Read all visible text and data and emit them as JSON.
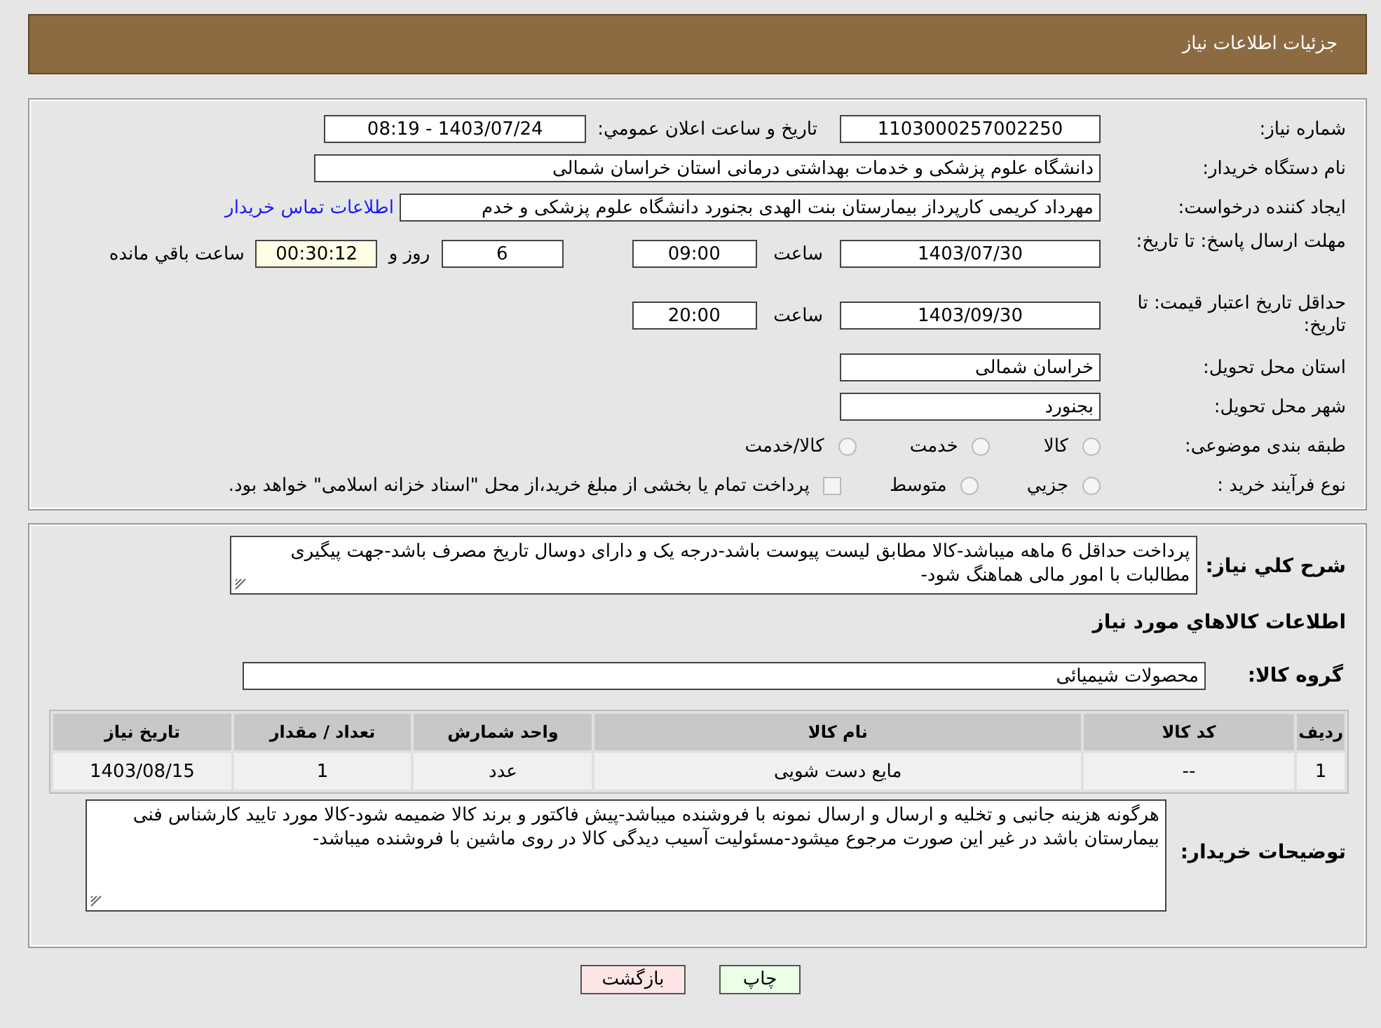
{
  "header": {
    "title": "جزئیات اطلاعات نیاز"
  },
  "need_number": {
    "label": "شماره نیاز:",
    "value": "1103000257002250"
  },
  "announce": {
    "label": "تاریخ و ساعت اعلان عمومي:",
    "value": "1403/07/24 - 08:19"
  },
  "buyer_org": {
    "label": "نام دستگاه خریدار:",
    "value": "دانشگاه علوم پزشکی و خدمات بهداشتی درمانی استان خراسان شمالی"
  },
  "requester": {
    "label": "ایجاد کننده درخواست:",
    "value": "مهرداد کریمی کارپرداز بیمارستان بنت الهدی بجنورد دانشگاه علوم پزشکی و خدم",
    "link": "اطلاعات تماس خریدار"
  },
  "response_deadline": {
    "label": "مهلت ارسال پاسخ: تا تاریخ:",
    "date": "1403/07/30",
    "time_label": "ساعت",
    "time": "09:00",
    "days": "6",
    "days_label": "روز و",
    "remaining": "00:30:12",
    "remaining_label": "ساعت باقي مانده"
  },
  "price_validity": {
    "label": "حداقل تاریخ اعتبار قیمت: تا تاریخ:",
    "date": "1403/09/30",
    "time_label": "ساعت",
    "time": "20:00"
  },
  "delivery_province": {
    "label": "استان محل تحویل:",
    "value": "خراسان شمالی"
  },
  "delivery_city": {
    "label": "شهر محل تحویل:",
    "value": "بجنورد"
  },
  "category": {
    "label": "طبقه بندی موضوعی:",
    "options": [
      {
        "label": "کالا",
        "selected": false
      },
      {
        "label": "خدمت",
        "selected": false
      },
      {
        "label": "کالا/خدمت",
        "selected": false
      }
    ]
  },
  "purchase_type": {
    "label": "نوع فرآیند خرید :",
    "options": [
      {
        "kind": "radio",
        "label": "جزيي",
        "selected": false
      },
      {
        "kind": "radio",
        "label": "متوسط",
        "selected": false
      },
      {
        "kind": "checkbox",
        "label": "پرداخت تمام یا بخشی از مبلغ خرید،از محل \"اسناد خزانه اسلامی\" خواهد بود.",
        "checked": false
      }
    ]
  },
  "description": {
    "label": "شرح کلي نياز:",
    "value": "پرداخت حداقل 6 ماهه میباشد-کالا مطابق لیست پیوست باشد-درجه یک و دارای دوسال تاریخ مصرف باشد-جهت پیگیری مطالبات با امور مالی هماهنگ شود-"
  },
  "goods_heading": "اطلاعات کالاهاي مورد نياز",
  "goods_group": {
    "label": "گروه کالا:",
    "value": "محصولات شیمیائی"
  },
  "table": {
    "columns": [
      "ردیف",
      "کد کالا",
      "نام کالا",
      "واحد شمارش",
      "تعداد / مقدار",
      "تاریخ نیاز"
    ],
    "rows": [
      [
        "1",
        "--",
        "مایع دست شویی",
        "عدد",
        "1",
        "1403/08/15"
      ]
    ]
  },
  "buyer_notes": {
    "label": "توضیحات خریدار:",
    "value": "هرگونه هزینه جانبی و تخلیه و ارسال و ارسال نمونه با فروشنده میباشد-پیش فاکتور و برند کالا ضمیمه شود-کالا مورد تایید کارشناس فنی بیمارستان باشد در غیر این صورت مرجوع میشود-مسئولیت آسیب دیدگی کالا در روی ماشین با فروشنده میباشد-"
  },
  "buttons": [
    {
      "kind": "print",
      "label": "چاپ"
    },
    {
      "kind": "back",
      "label": "بازگشت"
    }
  ]
}
